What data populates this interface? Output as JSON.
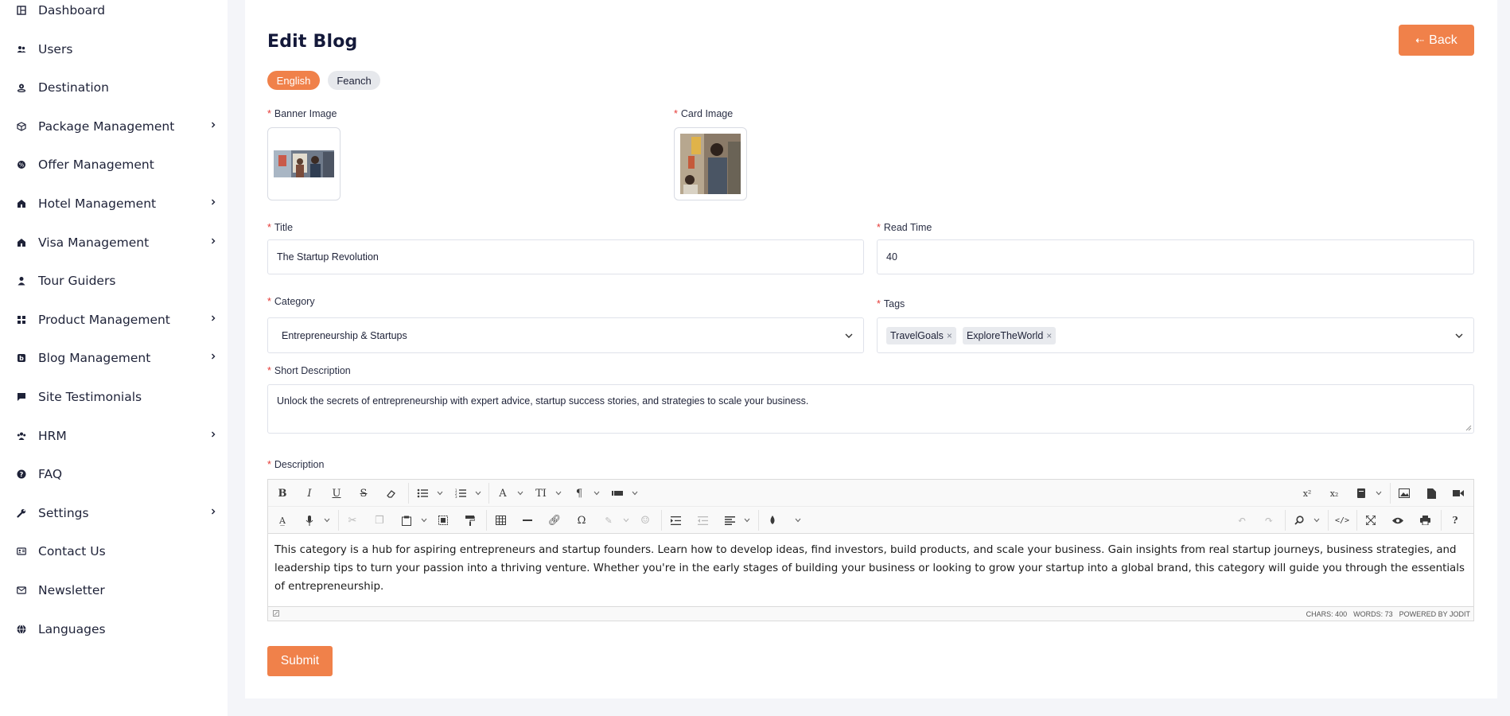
{
  "sidebar": {
    "items": [
      {
        "label": "Dashboard",
        "icon": "dashboard-icon",
        "has_submenu": false
      },
      {
        "label": "Users",
        "icon": "users-icon",
        "has_submenu": false
      },
      {
        "label": "Destination",
        "icon": "location-icon",
        "has_submenu": false
      },
      {
        "label": "Package Management",
        "icon": "package-icon",
        "has_submenu": true
      },
      {
        "label": "Offer Management",
        "icon": "offer-icon",
        "has_submenu": false
      },
      {
        "label": "Hotel Management",
        "icon": "hotel-icon",
        "has_submenu": true
      },
      {
        "label": "Visa Management",
        "icon": "visa-icon",
        "has_submenu": true
      },
      {
        "label": "Tour Guiders",
        "icon": "guide-icon",
        "has_submenu": false
      },
      {
        "label": "Product Management",
        "icon": "product-icon",
        "has_submenu": true
      },
      {
        "label": "Blog Management",
        "icon": "blog-icon",
        "has_submenu": true
      },
      {
        "label": "Site Testimonials",
        "icon": "testimonial-icon",
        "has_submenu": false
      },
      {
        "label": "HRM",
        "icon": "hrm-icon",
        "has_submenu": true
      },
      {
        "label": "FAQ",
        "icon": "faq-icon",
        "has_submenu": false
      },
      {
        "label": "Settings",
        "icon": "wrench-icon",
        "has_submenu": true
      },
      {
        "label": "Contact Us",
        "icon": "contact-card-icon",
        "has_submenu": false
      },
      {
        "label": "Newsletter",
        "icon": "mail-icon",
        "has_submenu": false
      },
      {
        "label": "Languages",
        "icon": "globe-icon",
        "has_submenu": false
      }
    ]
  },
  "header": {
    "title": "Edit Blog",
    "back_label": "Back",
    "back_icon": "arrow-left-icon"
  },
  "languages": {
    "active": "English",
    "other": "Feanch"
  },
  "form": {
    "banner_image_label": "Banner Image",
    "card_image_label": "Card Image",
    "title_label": "Title",
    "title_value": "The Startup Revolution",
    "read_time_label": "Read Time",
    "read_time_value": "40",
    "category_label": "Category",
    "category_value": "Entrepreneurship & Startups",
    "tags_label": "Tags",
    "tags": [
      "TravelGoals",
      "ExploreTheWorld"
    ],
    "short_description_label": "Short Description",
    "short_description_value": "Unlock the secrets of entrepreneurship with expert advice, startup success stories, and strategies to scale your business.",
    "description_label": "Description",
    "description_value": "This category is a hub for aspiring entrepreneurs and startup founders. Learn how to develop ideas, find investors, build products, and scale your business. Gain insights from real startup journeys, business strategies, and leadership tips to turn your passion into a thriving venture. Whether you're in the early stages of building your business or looking to grow your startup into a global brand, this category will guide you through the essentials of entrepreneurship.",
    "submit_label": "Submit"
  },
  "editor": {
    "chars": "CHARS: 400",
    "words": "WORDS: 73",
    "powered_by": "POWERED BY JODIT"
  },
  "colors": {
    "accent": "#f0814a",
    "text": "#1e2238",
    "required": "#e53935"
  }
}
